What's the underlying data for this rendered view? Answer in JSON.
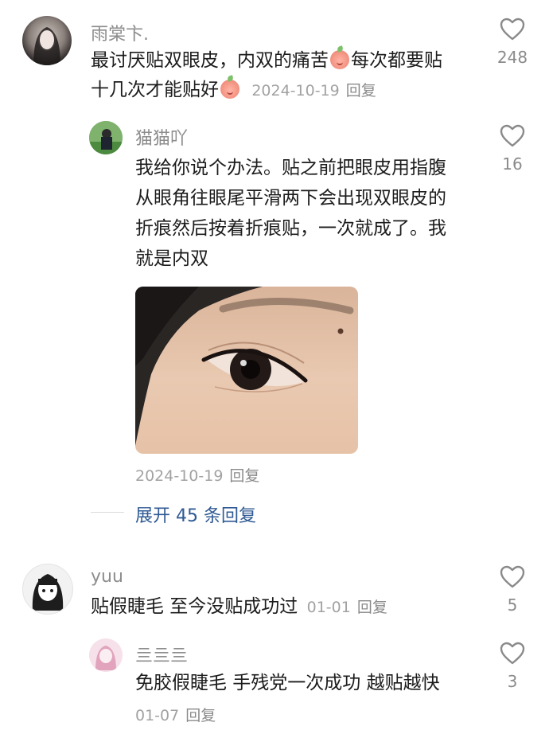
{
  "comments": [
    {
      "user": "雨棠卞.",
      "text_a": "最讨厌贴双眼皮，内双的痛苦",
      "text_b": "每次都要贴",
      "text_c": "十几次才能贴好",
      "date": "2024-10-19",
      "reply": "回复",
      "likes": "248",
      "emoji": "peach-face-emoji"
    },
    {
      "user": "猫猫吖",
      "line1": "我给你说个办法。贴之前把眼皮用指腹",
      "line2": "从眼角往眼尾平滑两下会出现双眼皮的",
      "line3": "折痕然后按着折痕贴，一次就成了。我",
      "line4": "就是内双",
      "date": "2024-10-19",
      "reply": "回复",
      "likes": "16"
    },
    {
      "user": "yuu",
      "text": "贴假睫毛 至今没贴成功过",
      "date": "01-01",
      "reply": "回复",
      "likes": "5"
    },
    {
      "user": "亖亖亖",
      "text": "免胶假睫毛 手残党一次成功 越贴越快",
      "date": "01-07",
      "reply": "回复",
      "likes": "3"
    }
  ],
  "expand_label": "展开 45 条回复",
  "icons": {
    "like": "heart-outline-icon"
  },
  "colors": {
    "link": "#2f5a94",
    "meta": "#a2a2a2",
    "username": "#8d8d8d"
  }
}
